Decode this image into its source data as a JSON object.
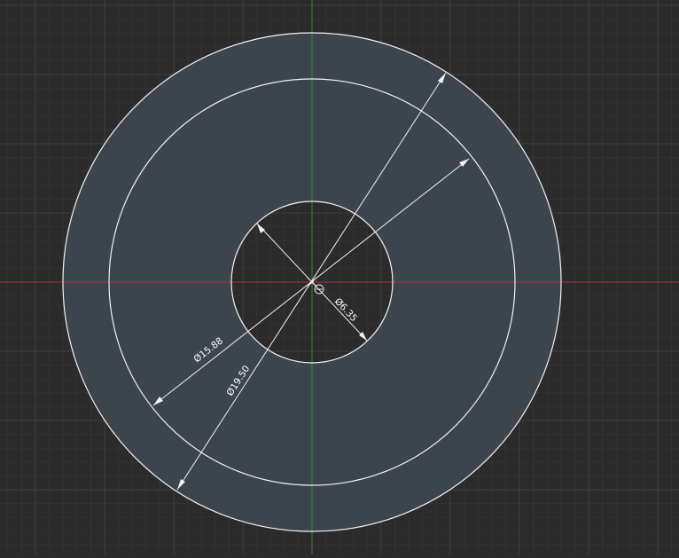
{
  "sketch": {
    "dimensions": {
      "inner_hole": "Ø6.35",
      "middle_circle": "Ø15.88",
      "outer_circle": "Ø19.50"
    },
    "colors": {
      "background": "#2b2b2b",
      "grid_minor": "#333333",
      "grid_major": "#3f3f3f",
      "face_fill": "#3d474f",
      "sketch_line": "#f2f2f2",
      "axis_vertical": "#2f8a3a",
      "axis_horizontal": "#9b3a3a"
    }
  }
}
